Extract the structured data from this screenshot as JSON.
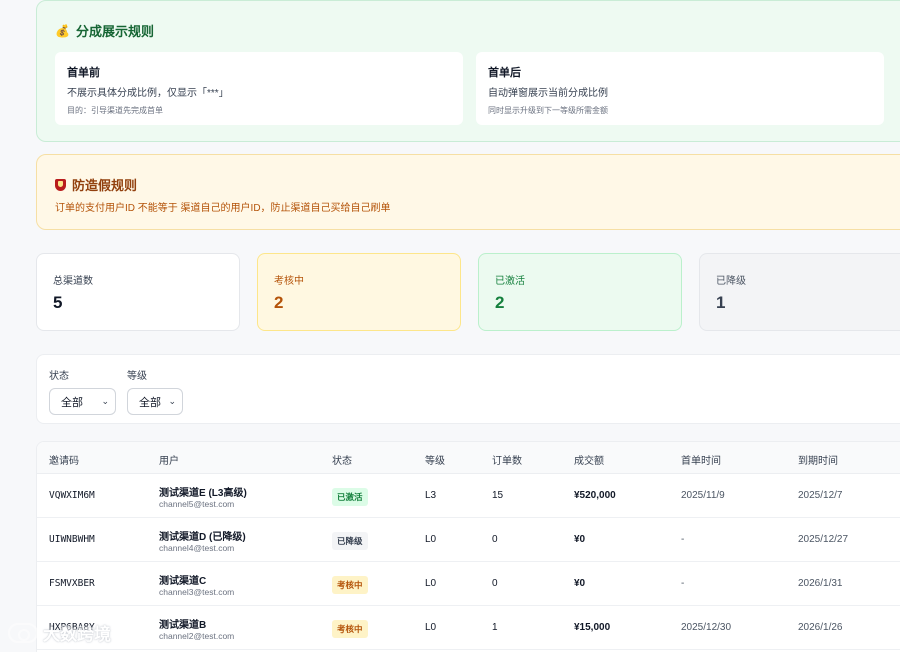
{
  "rules": {
    "title": "分成展示规则",
    "icon": "money-bag-icon",
    "before": {
      "heading": "首单前",
      "desc": "不展示具体分成比例，仅显示「***」",
      "note": "目的：引导渠道先完成首单"
    },
    "after": {
      "heading": "首单后",
      "desc": "自动弹窗展示当前分成比例",
      "note": "同时显示升级到下一等级所需金额"
    }
  },
  "fraud": {
    "title": "防造假规则",
    "icon": "shield-icon",
    "desc": "订单的支付用户ID 不能等于 渠道自己的用户ID，防止渠道自己买给自己刷单"
  },
  "stats": {
    "total": {
      "label": "总渠道数",
      "value": "5"
    },
    "review": {
      "label": "考核中",
      "value": "2"
    },
    "active": {
      "label": "已激活",
      "value": "2"
    },
    "down": {
      "label": "已降级",
      "value": "1"
    }
  },
  "filters": {
    "status": {
      "label": "状态",
      "value": "全部"
    },
    "level": {
      "label": "等级",
      "value": "全部"
    }
  },
  "table": {
    "headers": [
      "邀请码",
      "用户",
      "状态",
      "等级",
      "订单数",
      "成交额",
      "首单时间",
      "到期时间"
    ],
    "rows": [
      {
        "code": "VQWXIM6M",
        "name": "测试渠道E (L3高级)",
        "email": "channel5@test.com",
        "status": "已激活",
        "level": "L3",
        "orders": "15",
        "amount": "¥520,000",
        "first": "2025/11/9",
        "expire": "2025/12/7"
      },
      {
        "code": "UIWNBWHM",
        "name": "测试渠道D (已降级)",
        "email": "channel4@test.com",
        "status": "已降级",
        "level": "L0",
        "orders": "0",
        "amount": "¥0",
        "first": "-",
        "expire": "2025/12/27"
      },
      {
        "code": "FSMVXBER",
        "name": "测试渠道C",
        "email": "channel3@test.com",
        "status": "考核中",
        "level": "L0",
        "orders": "0",
        "amount": "¥0",
        "first": "-",
        "expire": "2026/1/31"
      },
      {
        "code": "HXP6BA8Y",
        "name": "测试渠道B",
        "email": "channel2@test.com",
        "status": "考核中",
        "level": "L0",
        "orders": "1",
        "amount": "¥15,000",
        "first": "2025/12/30",
        "expire": "2026/1/26"
      }
    ]
  },
  "watermark": {
    "text": "大数跨境"
  },
  "colors": {
    "success": "#15803d",
    "warning": "#b45309",
    "muted": "#374151"
  }
}
